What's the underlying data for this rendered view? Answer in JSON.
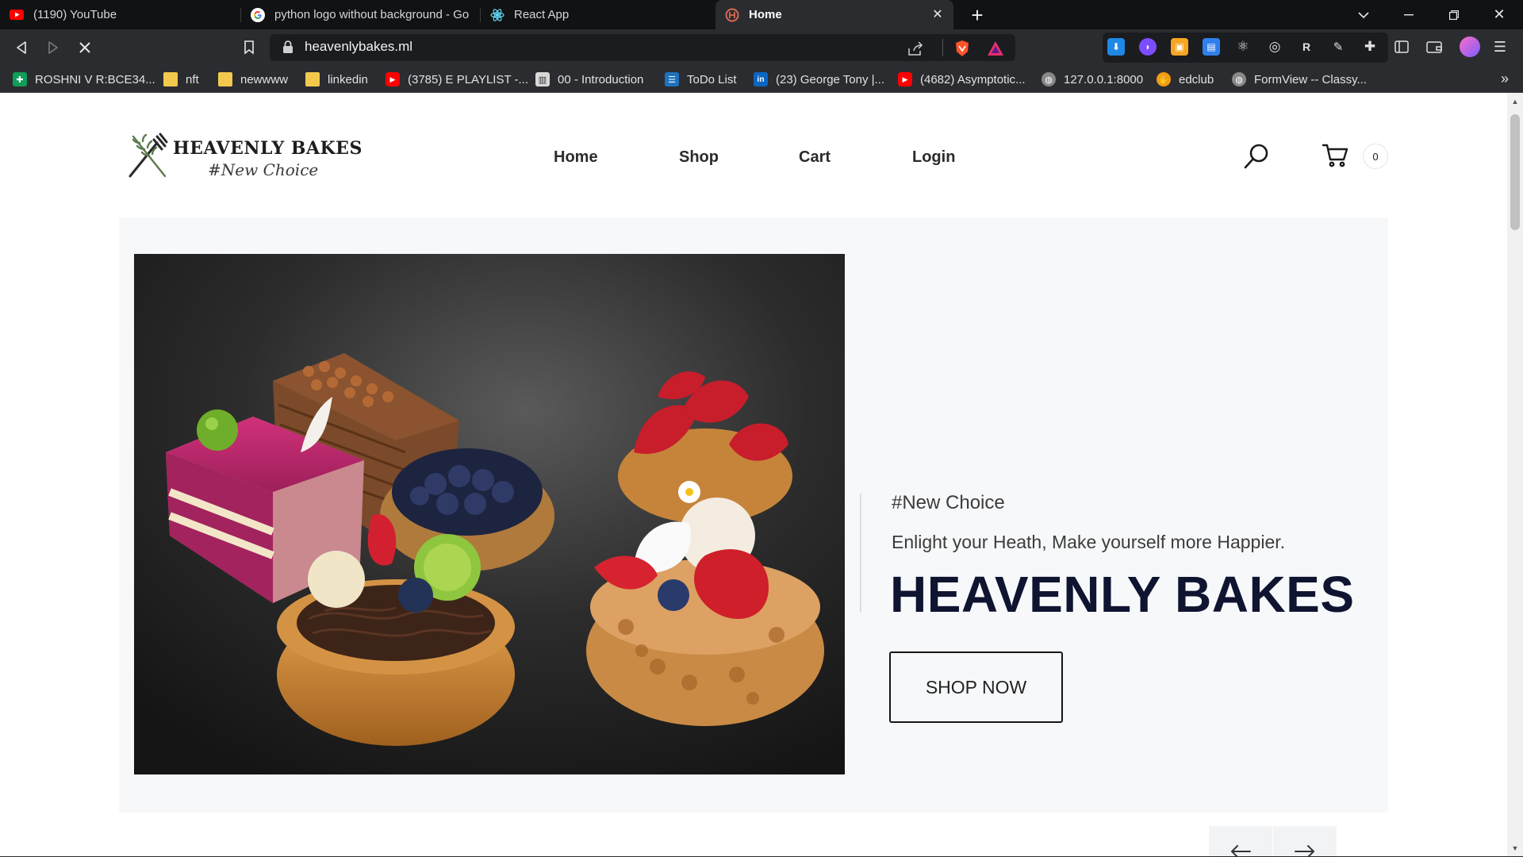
{
  "browser": {
    "tabs": [
      {
        "title": "(1190) YouTube",
        "icon": "youtube-icon"
      },
      {
        "title": "python logo without background - Go",
        "icon": "google-icon"
      },
      {
        "title": "React App",
        "icon": "react-icon"
      },
      {
        "title": "Home",
        "icon": "site-favicon",
        "active": true
      }
    ],
    "url": "heavenlybakes.ml",
    "bookmarks": [
      {
        "label": "ROSHNI V R:BCE34...",
        "icon": "sheets-icon"
      },
      {
        "label": "nft",
        "icon": "folder-icon"
      },
      {
        "label": "newwww",
        "icon": "folder-icon"
      },
      {
        "label": "linkedin",
        "icon": "folder-icon"
      },
      {
        "label": "(3785) E PLAYLIST -...",
        "icon": "youtube-icon"
      },
      {
        "label": "00 - Introduction",
        "icon": "building-icon"
      },
      {
        "label": "ToDo List",
        "icon": "todo-icon"
      },
      {
        "label": "(23) George Tony |...",
        "icon": "linkedin-icon"
      },
      {
        "label": "(4682) Asymptotic...",
        "icon": "youtube-icon"
      },
      {
        "label": "127.0.0.1:8000",
        "icon": "globe-icon"
      },
      {
        "label": "edclub",
        "icon": "edclub-icon"
      },
      {
        "label": "FormView -- Classy...",
        "icon": "globe-icon"
      }
    ]
  },
  "site": {
    "logo": {
      "title": "HEAVENLY BAKES",
      "subtitle": "#New Choice"
    },
    "nav": [
      "Home",
      "Shop",
      "Cart",
      "Login"
    ],
    "cart_count": "0"
  },
  "hero": {
    "eyebrow": "#New Choice",
    "tagline": "Enlight your Heath, Make yourself more Happier.",
    "headline": "HEAVENLY BAKES",
    "cta": "SHOP NOW"
  },
  "colors": {
    "headline": "#0f1430",
    "hero_bg": "#f7f8fa",
    "chrome_dark": "#111214",
    "chrome_toolbar": "#2b2c30"
  }
}
